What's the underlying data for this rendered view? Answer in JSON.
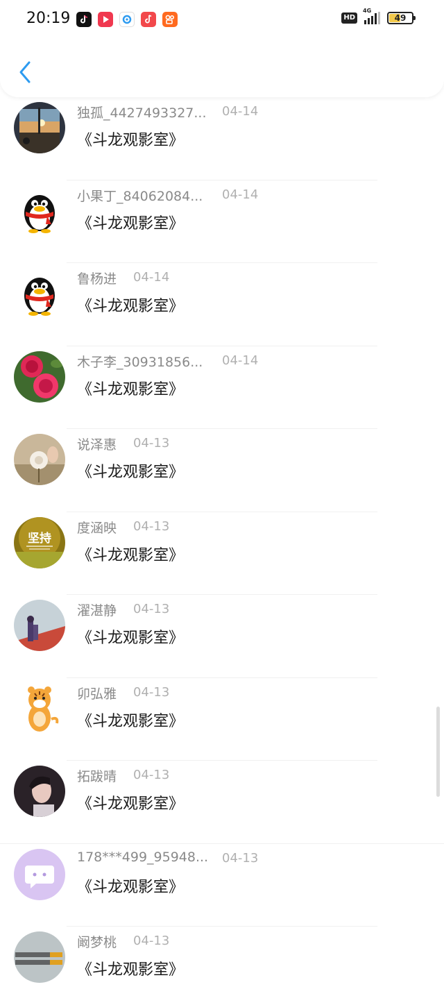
{
  "status_bar": {
    "time": "20:19",
    "hd_label": "HD",
    "network_label": "4G",
    "battery_level": "49",
    "battery_percent": 49,
    "app_icons": [
      "douyin-icon",
      "video-play-icon",
      "browser-icon",
      "music-icon",
      "kuaishou-icon"
    ]
  },
  "header": {
    "back_icon": "chevron-left-icon"
  },
  "messages": [
    {
      "name": "独孤_4427493327...",
      "date": "04-14",
      "text": "《斗龙观影室》",
      "avatar": "sunset-window-avatar"
    },
    {
      "name": "小果丁_84062084...",
      "date": "04-14",
      "text": "《斗龙观影室》",
      "avatar": "penguin-avatar"
    },
    {
      "name": "鲁杨进",
      "date": "04-14",
      "text": "《斗龙观影室》",
      "avatar": "penguin-avatar"
    },
    {
      "name": "木子李_30931856...",
      "date": "04-14",
      "text": "《斗龙观影室》",
      "avatar": "rose-avatar"
    },
    {
      "name": "说泽惠",
      "date": "04-13",
      "text": "《斗龙观影室》",
      "avatar": "dandelion-avatar"
    },
    {
      "name": "度涵映",
      "date": "04-13",
      "text": "《斗龙观影室》",
      "avatar": "jianchi-avatar",
      "avatar_text": "坚持"
    },
    {
      "name": "濯湛静",
      "date": "04-13",
      "text": "《斗龙观影室》",
      "avatar": "rooftop-couple-avatar"
    },
    {
      "name": "卯弘雅",
      "date": "04-13",
      "text": "《斗龙观影室》",
      "avatar": "tiger-cartoon-avatar"
    },
    {
      "name": "拓跋晴",
      "date": "04-13",
      "text": "《斗龙观影室》",
      "avatar": "portrait-avatar"
    },
    {
      "name": "178***499_95948...",
      "date": "04-13",
      "text": "《斗龙观影室》",
      "avatar": "chat-bubble-avatar"
    },
    {
      "name": "阚梦桃",
      "date": "04-13",
      "text": "《斗龙观影室》",
      "avatar": "text-sign-avatar"
    }
  ],
  "colors": {
    "accent": "#2d9bf0",
    "name_text": "#8a8a8a",
    "date_text": "#b0b0b0",
    "message_text": "#1a1a1a",
    "divider": "#f0f0f0"
  }
}
